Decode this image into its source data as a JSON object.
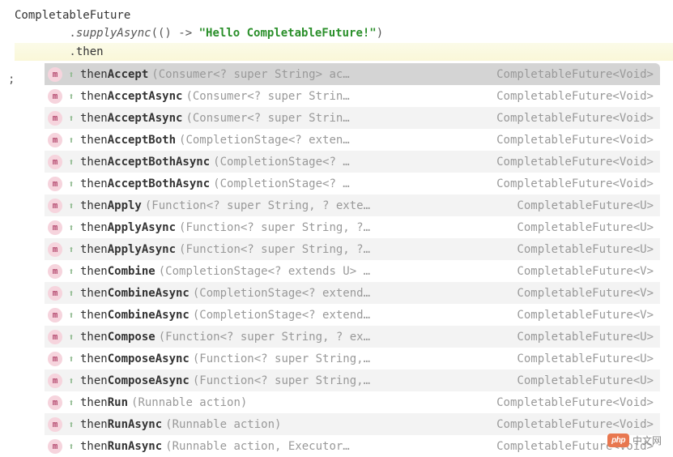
{
  "code": {
    "line1": "CompletableFuture",
    "line2_indent": "        .",
    "line2_method": "supplyAsync",
    "line2_open": "(() -> ",
    "line2_string": "\"Hello CompletableFuture!\"",
    "line2_close": ")",
    "line3_indent": "        .",
    "line3_text": "then",
    "semicolon": ";"
  },
  "icons": {
    "m": "m",
    "lock": "⬆"
  },
  "completion": {
    "prefix": "then",
    "items": [
      {
        "bold": "Accept",
        "params": "(Consumer<? super String> ac…",
        "ret": "CompletableFuture<Void>",
        "sel": true
      },
      {
        "bold": "AcceptAsync",
        "params": "(Consumer<? super Strin…",
        "ret": "CompletableFuture<Void>"
      },
      {
        "bold": "AcceptAsync",
        "params": "(Consumer<? super Strin…",
        "ret": "CompletableFuture<Void>"
      },
      {
        "bold": "AcceptBoth",
        "params": "(CompletionStage<? exten…",
        "ret": "CompletableFuture<Void>"
      },
      {
        "bold": "AcceptBothAsync",
        "params": "(CompletionStage<? …",
        "ret": "CompletableFuture<Void>"
      },
      {
        "bold": "AcceptBothAsync",
        "params": "(CompletionStage<? …",
        "ret": "CompletableFuture<Void>"
      },
      {
        "bold": "Apply",
        "params": "(Function<? super String, ? exte…",
        "ret": "CompletableFuture<U>"
      },
      {
        "bold": "ApplyAsync",
        "params": "(Function<? super String, ?…",
        "ret": "CompletableFuture<U>"
      },
      {
        "bold": "ApplyAsync",
        "params": "(Function<? super String, ?…",
        "ret": "CompletableFuture<U>"
      },
      {
        "bold": "Combine",
        "params": "(CompletionStage<? extends U> …",
        "ret": "CompletableFuture<V>"
      },
      {
        "bold": "CombineAsync",
        "params": "(CompletionStage<? extend…",
        "ret": "CompletableFuture<V>"
      },
      {
        "bold": "CombineAsync",
        "params": "(CompletionStage<? extend…",
        "ret": "CompletableFuture<V>"
      },
      {
        "bold": "Compose",
        "params": "(Function<? super String, ? ex…",
        "ret": "CompletableFuture<U>"
      },
      {
        "bold": "ComposeAsync",
        "params": "(Function<? super String,…",
        "ret": "CompletableFuture<U>"
      },
      {
        "bold": "ComposeAsync",
        "params": "(Function<? super String,…",
        "ret": "CompletableFuture<U>"
      },
      {
        "bold": "Run",
        "params": "(Runnable action)",
        "ret": "CompletableFuture<Void>"
      },
      {
        "bold": "RunAsync",
        "params": "(Runnable action)",
        "ret": "CompletableFuture<Void>"
      },
      {
        "bold": "RunAsync",
        "params": "(Runnable action, Executor…",
        "ret": "CompletableFuture<Void>"
      }
    ]
  },
  "watermark": {
    "badge": "php",
    "text": "中文网"
  }
}
